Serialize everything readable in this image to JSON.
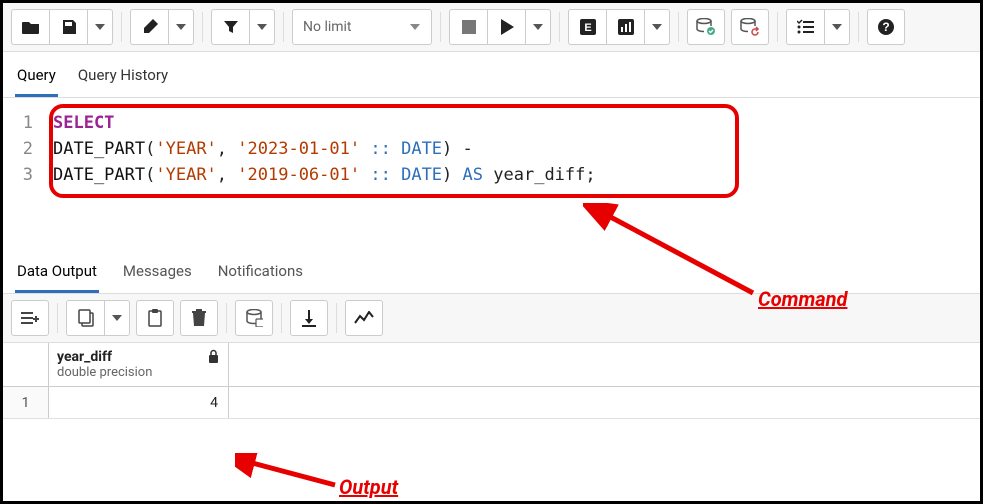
{
  "toolbar": {
    "limit_label": "No limit"
  },
  "tabs": {
    "query": "Query",
    "history": "Query History"
  },
  "editor": {
    "lines": [
      "1",
      "2",
      "3"
    ],
    "code": {
      "select": "SELECT",
      "fn": "DATE_PART",
      "arg1a": "'YEAR'",
      "arg1b": "'2023-01-01'",
      "arg2a": "'YEAR'",
      "arg2b": "'2019-06-01'",
      "castop": "::",
      "casttype": "DATE",
      "minus": "-",
      "askw": "AS",
      "alias": "year_diff",
      "semi": ";"
    }
  },
  "out_tabs": {
    "data": "Data Output",
    "messages": "Messages",
    "notifications": "Notifications"
  },
  "results": {
    "col_name": "year_diff",
    "col_type": "double precision",
    "row_num": "1",
    "cell_value": "4"
  },
  "annotations": {
    "command": "Command",
    "output": "Output"
  }
}
